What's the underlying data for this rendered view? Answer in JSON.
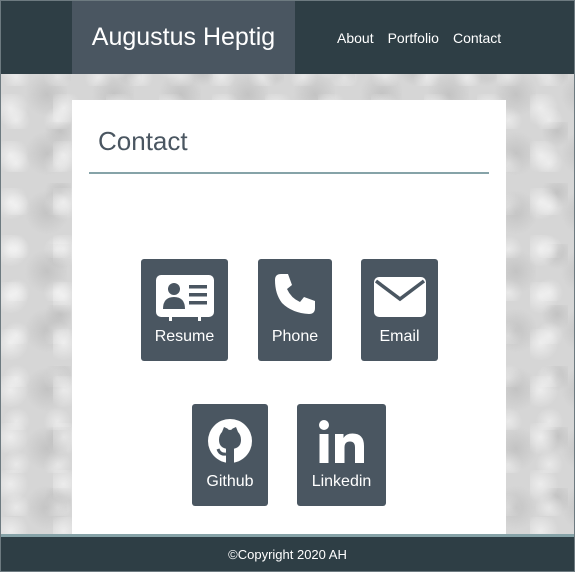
{
  "brand": {
    "name": "Augustus Heptig"
  },
  "nav": {
    "items": [
      {
        "label": "About"
      },
      {
        "label": "Portfolio"
      },
      {
        "label": "Contact"
      }
    ]
  },
  "page": {
    "title": "Contact"
  },
  "contacts": [
    {
      "label": "Resume",
      "icon": "id-card-icon"
    },
    {
      "label": "Phone",
      "icon": "phone-icon"
    },
    {
      "label": "Email",
      "icon": "envelope-icon"
    },
    {
      "label": "Github",
      "icon": "github-icon"
    },
    {
      "label": "Linkedin",
      "icon": "linkedin-icon"
    }
  ],
  "footer": {
    "text": "©Copyright 2020 AH"
  },
  "colors": {
    "navbar": "#2e3e45",
    "brand_bg": "#4a5661",
    "card_bg": "#4a5661",
    "accent_rule": "#86a3a8"
  }
}
